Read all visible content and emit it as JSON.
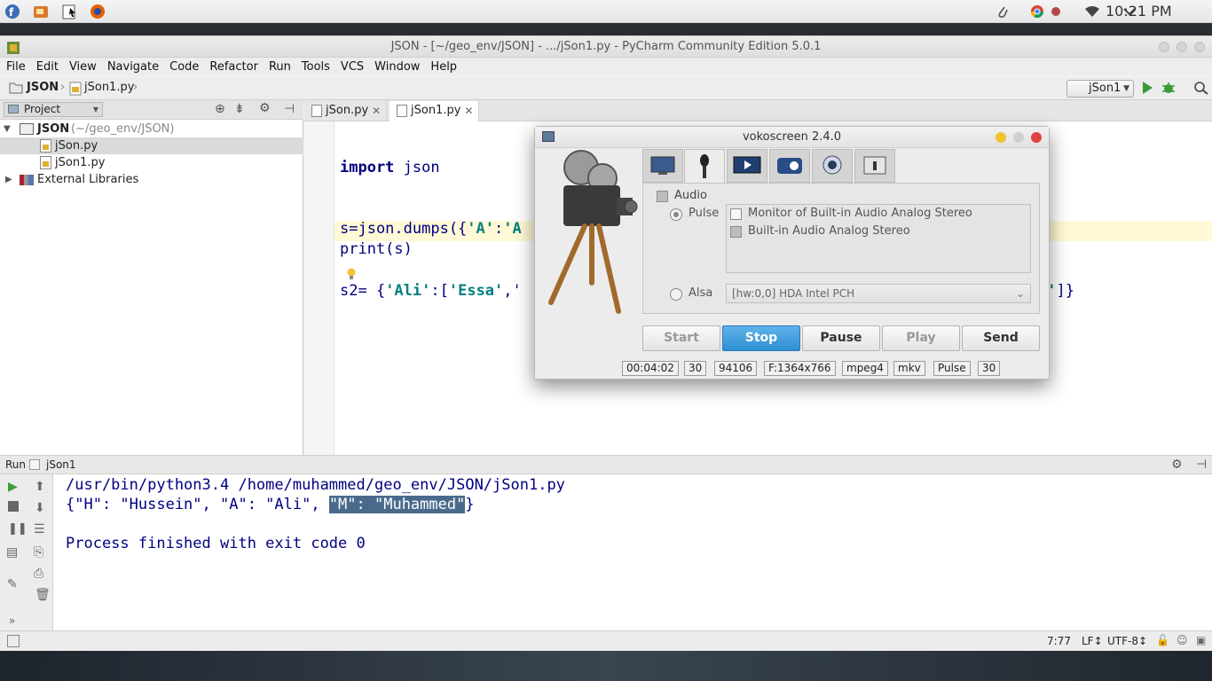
{
  "top_panel": {
    "launchers": [
      "fedora-icon",
      "paint-icon",
      "files-icon",
      "firefox-icon"
    ],
    "tray": [
      "paperclip-icon",
      "chrome-icon",
      "record-icon",
      "wifi-icon",
      "chevron-down-icon"
    ],
    "clock": "10:21 PM"
  },
  "window": {
    "title": "JSON - [~/geo_env/JSON] - .../jSon1.py - PyCharm Community Edition 5.0.1"
  },
  "menu": [
    "File",
    "Edit",
    "View",
    "Navigate",
    "Code",
    "Refactor",
    "Run",
    "Tools",
    "VCS",
    "Window",
    "Help"
  ],
  "navbar": {
    "crumb1": "JSON",
    "crumb2": "jSon1.py",
    "run_config": "jSon1"
  },
  "project": {
    "header": "Project",
    "root": "JSON",
    "root_path": "(~/geo_env/JSON)",
    "files": [
      "jSon.py",
      "jSon1.py"
    ],
    "external": "External Libraries"
  },
  "editor": {
    "tabs": [
      "jSon.py",
      "jSon1.py"
    ],
    "lines": {
      "l1a": "import ",
      "l1b": "json",
      "l4a": "s=json.dumps({",
      "l4b": "'A'",
      "l4c": ":",
      "l4d": "'A",
      "l5": "print(s)",
      "l7a": "s2= {",
      "l7b": "'Ali'",
      "l7c": ":[",
      "l7d": "'Essa'",
      "l7e": ",'",
      "l7f": "T'",
      "l7g": "]}"
    }
  },
  "run": {
    "label": "Run",
    "config": "jSon1",
    "cmd": "/usr/bin/python3.4 /home/muhammed/geo_env/JSON/jSon1.py",
    "out_a": "{\"H\": \"Hussein\", \"A\": \"Ali\", ",
    "out_sel": "\"M\": \"Muhammed\"",
    "out_b": "}",
    "exit": "Process finished with exit code 0"
  },
  "status": {
    "position": "7:77",
    "line_sep": "LF↕",
    "encoding": "UTF-8↕"
  },
  "voko": {
    "title": "vokoscreen 2.4.0",
    "audio": "Audio",
    "pulse": "Pulse",
    "devices": [
      "Monitor of Built-in Audio Analog Stereo",
      "Built-in Audio Analog Stereo"
    ],
    "alsa": "Alsa",
    "alsa_device": "[hw:0,0] HDA Intel PCH",
    "buttons": [
      "Start",
      "Stop",
      "Pause",
      "Play",
      "Send"
    ],
    "status": [
      "00:04:02",
      "30",
      "94106",
      "F:1364x766",
      "mpeg4",
      "mkv",
      "Pulse",
      "30"
    ],
    "active_color": "#3a9ad9"
  }
}
